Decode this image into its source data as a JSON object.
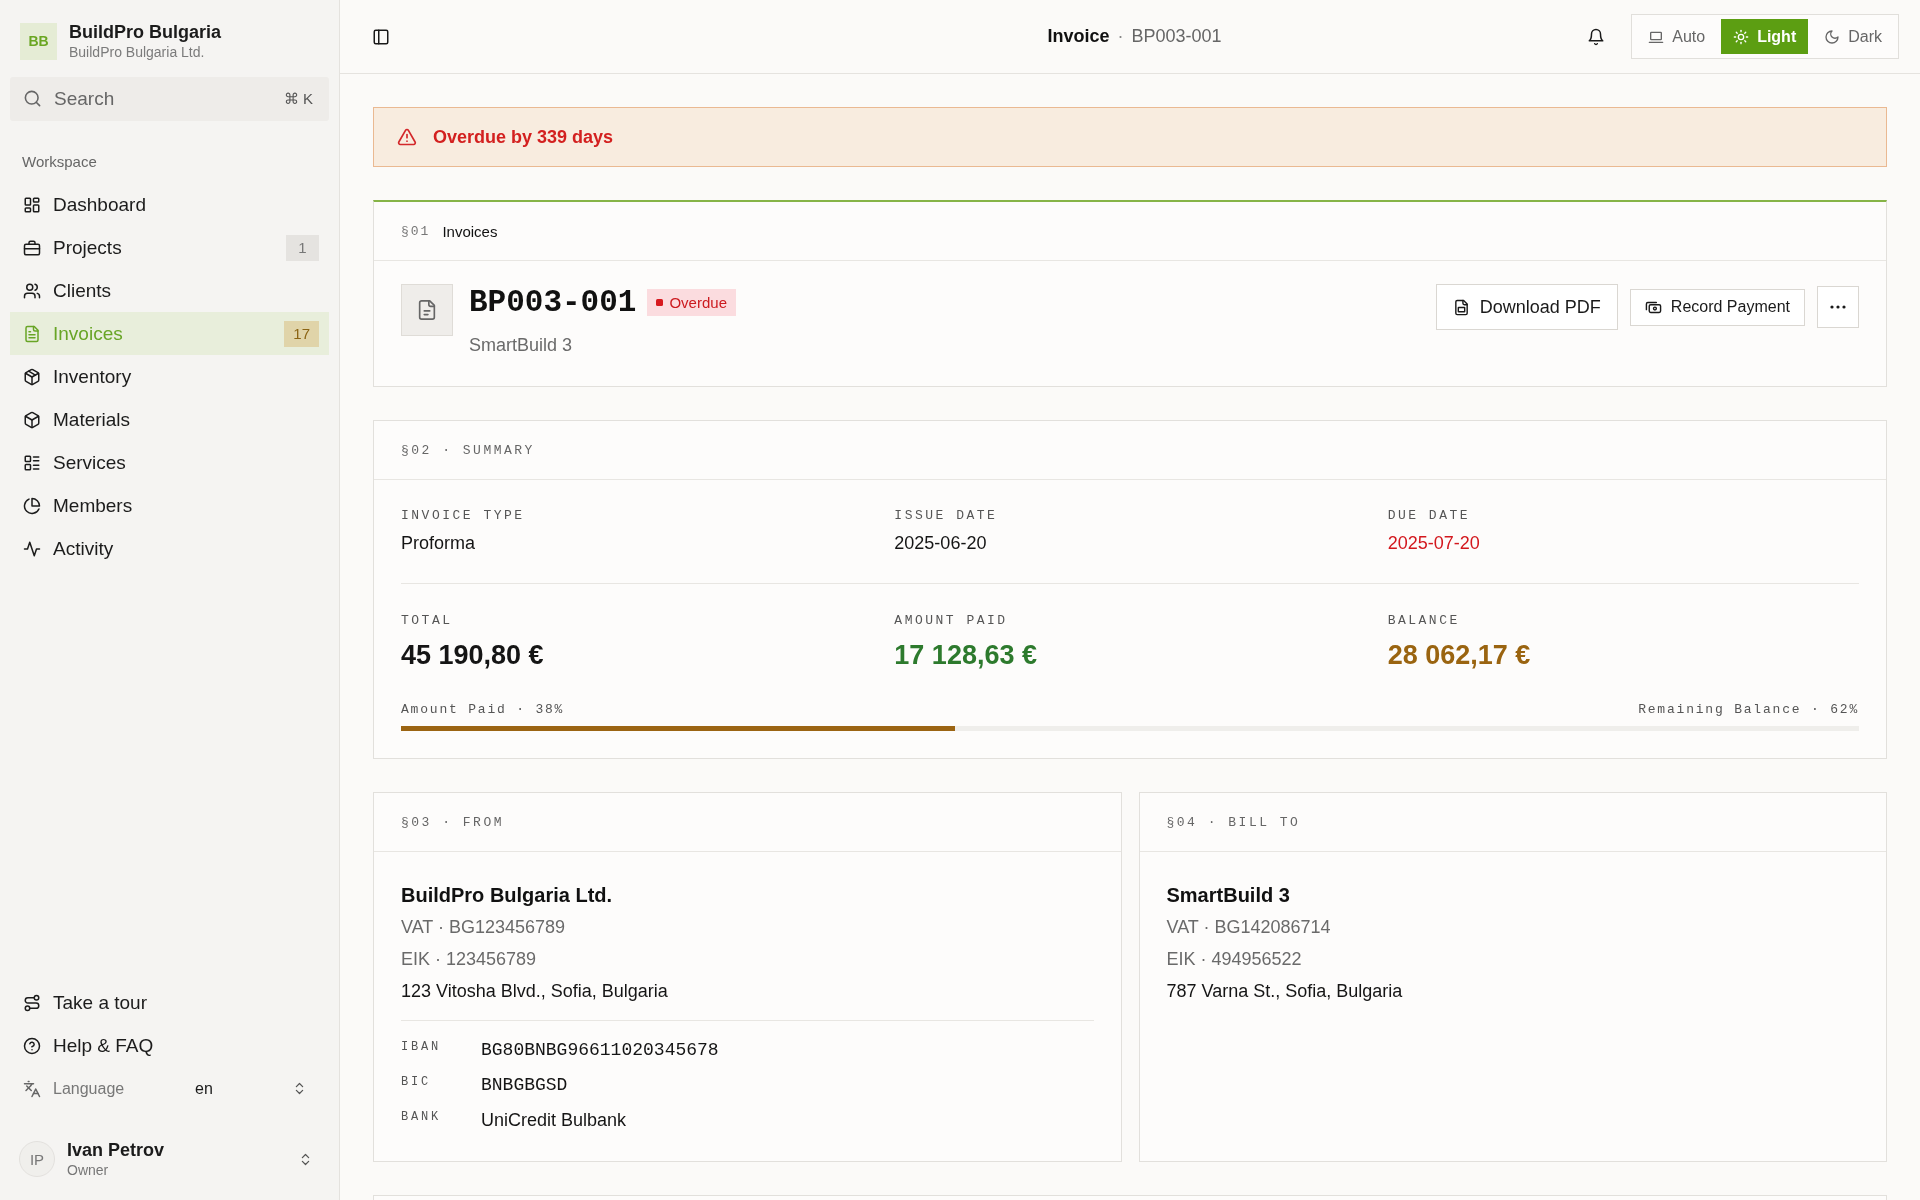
{
  "sidebar": {
    "org": {
      "initials": "BB",
      "name": "BuildPro Bulgaria",
      "legal_name": "BuildPro Bulgaria Ltd."
    },
    "search": {
      "placeholder": "Search",
      "shortcut": "⌘ K"
    },
    "nav": {
      "heading": "Workspace",
      "items": [
        {
          "label": "Dashboard",
          "selected": false
        },
        {
          "label": "Projects",
          "badge": "1",
          "selected": false
        },
        {
          "label": "Clients",
          "selected": false
        },
        {
          "label": "Invoices",
          "badge": "17",
          "selected": true
        },
        {
          "label": "Inventory",
          "selected": false
        },
        {
          "label": "Materials",
          "selected": false
        },
        {
          "label": "Services",
          "selected": false
        },
        {
          "label": "Members",
          "selected": false
        },
        {
          "label": "Activity",
          "selected": false
        }
      ]
    },
    "footer_links": [
      {
        "label": "Take a tour"
      },
      {
        "label": "Help & FAQ"
      }
    ],
    "language": {
      "label": "Language",
      "value": "en"
    },
    "user": {
      "initials": "IP",
      "name": "Ivan Petrov",
      "role": "Owner"
    }
  },
  "top_bar": {
    "breadcrumb": {
      "section": "Invoice",
      "separator": "·",
      "current": "BP003-001"
    },
    "theme_options": [
      {
        "label": "Auto",
        "selected": false
      },
      {
        "label": "Light",
        "selected": true
      },
      {
        "label": "Dark",
        "selected": false
      }
    ]
  },
  "alert": {
    "message": "Overdue by 339 days"
  },
  "invoice": {
    "section_number": "§01",
    "section_title": "Invoices",
    "number": "BP003-001",
    "status": "Overdue",
    "client": "SmartBuild 3",
    "actions": [
      {
        "label": "Download PDF",
        "kind": "primary"
      },
      {
        "label": "Record Payment",
        "kind": "secondary"
      }
    ]
  },
  "summary": {
    "heading": "§02 · SUMMARY",
    "fields": [
      {
        "label": "INVOICE TYPE",
        "value": "Proforma",
        "overdue": false
      },
      {
        "label": "ISSUE DATE",
        "value": "2025-06-20",
        "overdue": false
      },
      {
        "label": "DUE DATE",
        "value": "2025-07-20",
        "overdue": true
      }
    ],
    "amounts": [
      {
        "label": "TOTAL",
        "value": "45 190,80 €",
        "color": "#151515"
      },
      {
        "label": "AMOUNT PAID",
        "value": "17 128,63 €",
        "color": "#2d7a2d"
      },
      {
        "label": "BALANCE",
        "value": "28 062,17 €",
        "color": "#9a6410"
      }
    ],
    "progress": {
      "left_label": "Amount Paid · 38%",
      "right_label": "Remaining Balance · 62%",
      "level": 0.38
    }
  },
  "parties": [
    {
      "heading": "§03 · FROM",
      "name": "BuildPro Bulgaria Ltd.",
      "vat": "VAT · BG123456789",
      "eik": "EIK · 123456789",
      "address": "123 Vitosha Blvd., Sofia, Bulgaria",
      "bank_details": [
        {
          "label": "IBAN",
          "value": "BG80BNBG96611020345678",
          "kind": "code"
        },
        {
          "label": "BIC",
          "value": "BNBGBGSD",
          "kind": "code"
        },
        {
          "label": "BANK",
          "value": "UniCredit Bulbank",
          "kind": "text"
        }
      ]
    },
    {
      "heading": "§04 · BILL TO",
      "name": "SmartBuild 3",
      "vat": "VAT · BG142086714",
      "eik": "EIK · 494956522",
      "address": "787 Varna St., Sofia, Bulgaria"
    }
  ]
}
